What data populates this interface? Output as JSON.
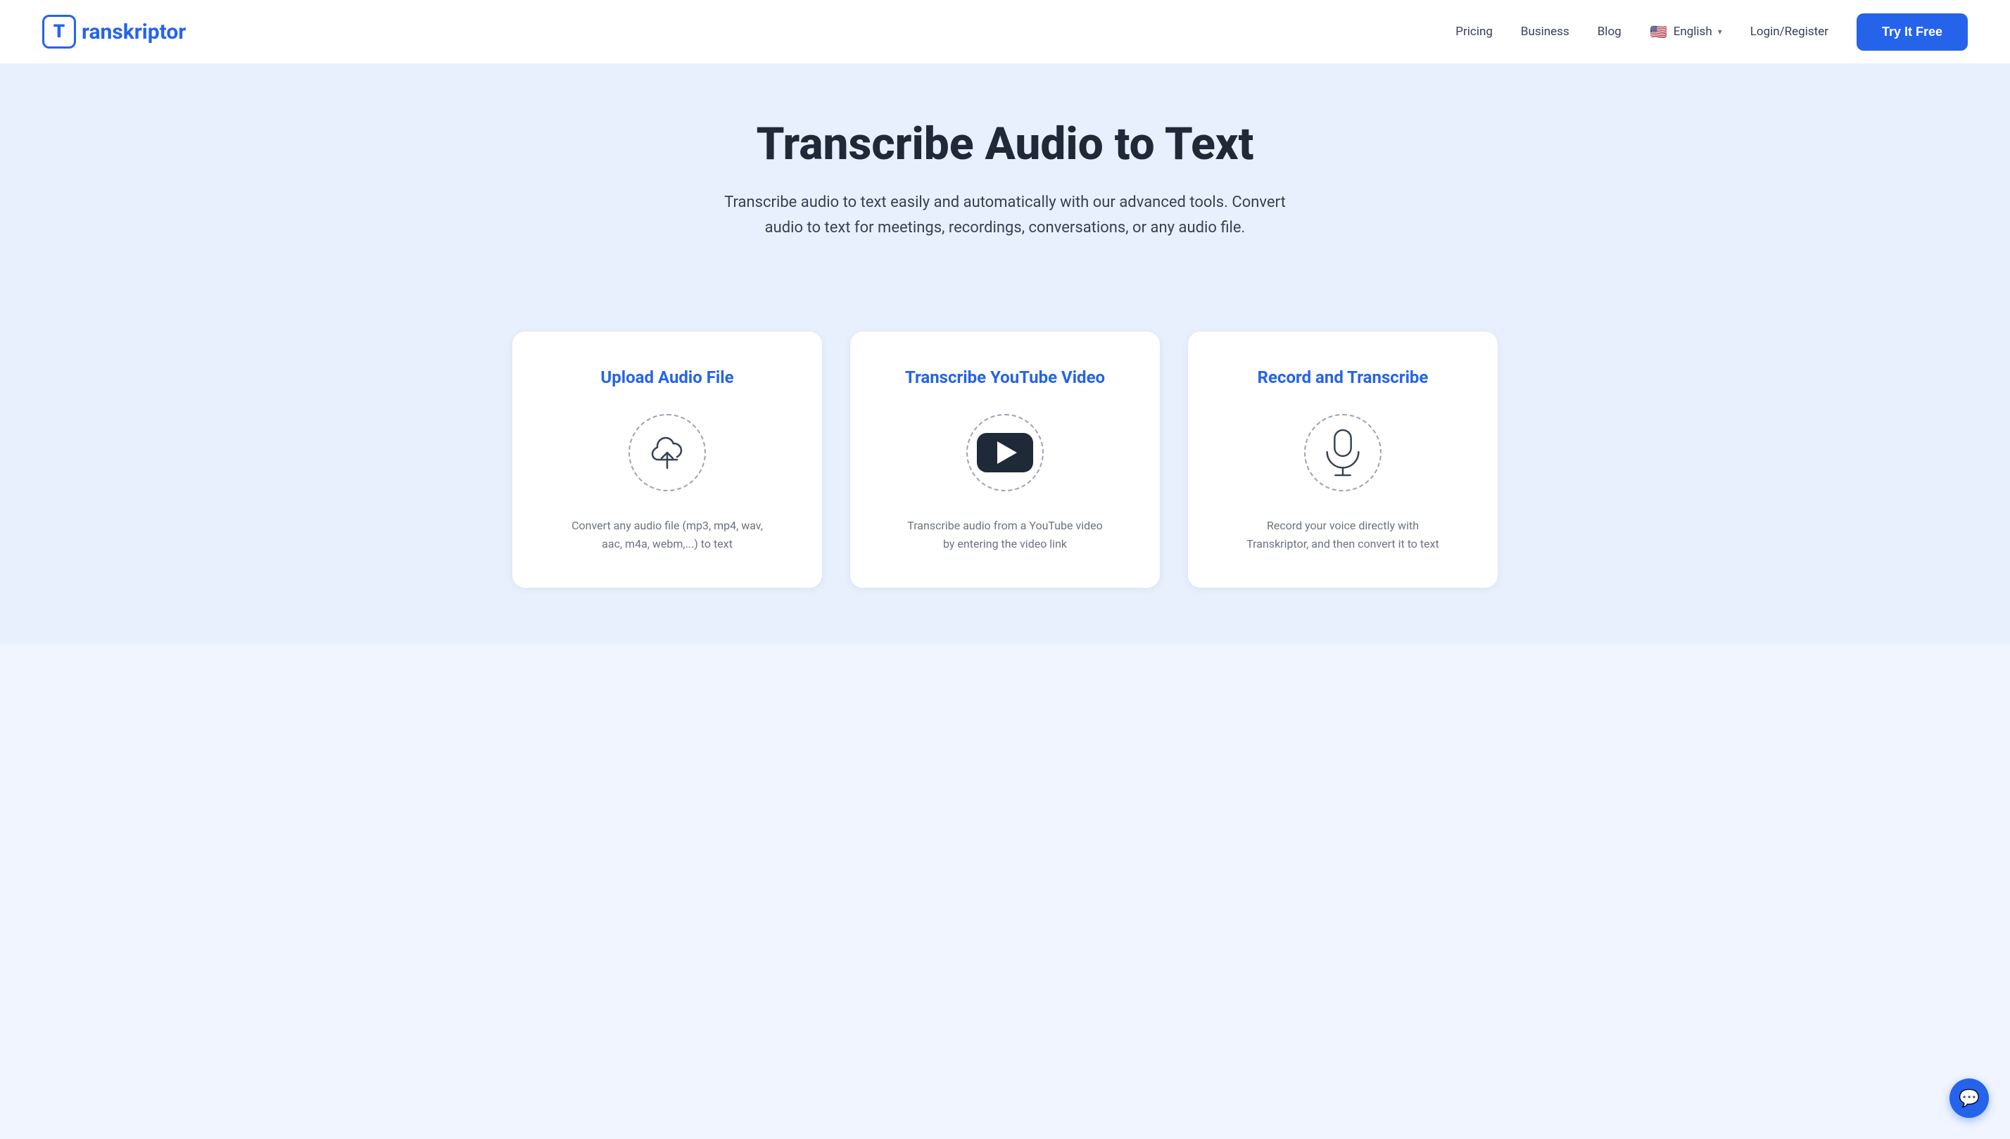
{
  "navbar": {
    "logo_letter": "T",
    "logo_name": "ranskriptor",
    "links": [
      {
        "label": "Pricing",
        "name": "pricing-link"
      },
      {
        "label": "Business",
        "name": "business-link"
      },
      {
        "label": "Blog",
        "name": "blog-link"
      }
    ],
    "language": {
      "flag": "🇺🇸",
      "label": "English"
    },
    "login_label": "Login/Register",
    "try_free_label": "Try It Free"
  },
  "hero": {
    "title": "Transcribe Audio to Text",
    "subtitle": "Transcribe audio to text easily and automatically with our advanced tools. Convert audio to text for meetings, recordings, conversations, or any audio file."
  },
  "cards": [
    {
      "id": "upload-audio",
      "title": "Upload Audio File",
      "icon_type": "upload",
      "description": "Convert any audio file (mp3, mp4, wav, aac, m4a, webm,...) to text"
    },
    {
      "id": "transcribe-youtube",
      "title": "Transcribe YouTube Video",
      "icon_type": "youtube",
      "description": "Transcribe audio from a YouTube video by entering the video link"
    },
    {
      "id": "record-transcribe",
      "title": "Record and Transcribe",
      "icon_type": "microphone",
      "description": "Record your voice directly with Transkriptor, and then convert it to text"
    }
  ],
  "chat": {
    "icon": "💬"
  }
}
